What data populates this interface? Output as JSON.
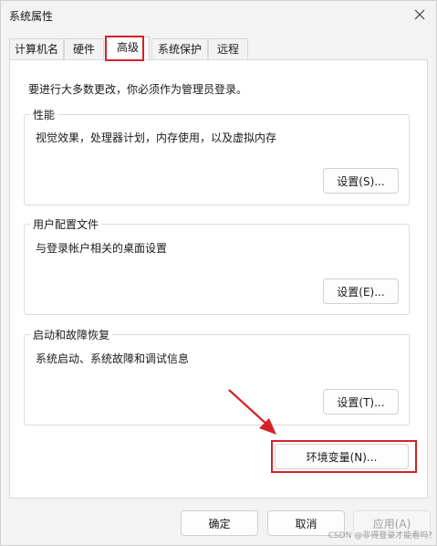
{
  "window": {
    "title": "系统属性",
    "close_icon": "close-icon"
  },
  "tabs": [
    {
      "label": "计算机名",
      "active": false
    },
    {
      "label": "硬件",
      "active": false
    },
    {
      "label": "高级",
      "active": true
    },
    {
      "label": "系统保护",
      "active": false
    },
    {
      "label": "远程",
      "active": false
    }
  ],
  "advanced": {
    "intro": "要进行大多数更改，你必须作为管理员登录。",
    "performance": {
      "title": "性能",
      "description": "视觉效果，处理器计划，内存使用，以及虚拟内存",
      "button": "设置(S)..."
    },
    "user_profiles": {
      "title": "用户配置文件",
      "description": "与登录帐户相关的桌面设置",
      "button": "设置(E)..."
    },
    "startup_recovery": {
      "title": "启动和故障恢复",
      "description": "系统启动、系统故障和调试信息",
      "button": "设置(T)..."
    },
    "env_button": "环境变量(N)..."
  },
  "footer": {
    "ok": "确定",
    "cancel": "取消",
    "apply": "应用(A)"
  },
  "annotations": {
    "highlight_color": "#d4222a"
  },
  "watermark": "CSDN @非得登录才能看吗?"
}
